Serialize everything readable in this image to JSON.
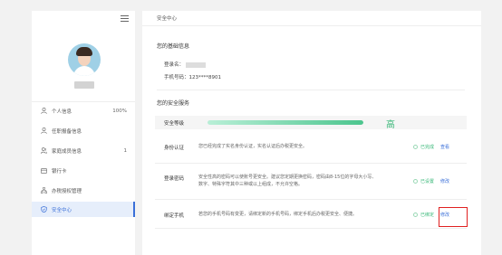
{
  "sidebar": {
    "items": [
      {
        "label": "个人信息",
        "icon": "user-icon",
        "count": "100%"
      },
      {
        "label": "任职报备信息",
        "icon": "user-icon",
        "count": ""
      },
      {
        "label": "家庭成员信息",
        "icon": "users-icon",
        "count": "1"
      },
      {
        "label": "银行卡",
        "icon": "card-icon",
        "count": ""
      },
      {
        "label": "办税授权管理",
        "icon": "org-icon",
        "count": ""
      },
      {
        "label": "安全中心",
        "icon": "shield-icon",
        "count": ""
      }
    ]
  },
  "main": {
    "breadcrumb": "安全中心",
    "basic_title": "您的基础信息",
    "login_label": "登录名：",
    "phone_line": "手机号码：123****8901",
    "security_title": "您的安全服务",
    "level_label": "安全等级",
    "level_value": "高",
    "level_percent": 100,
    "rows": [
      {
        "name": "身份认证",
        "desc": "您已经完成了实名身份认证，实名认证后办税更安全。",
        "status": "已完成",
        "action": "查看"
      },
      {
        "name": "登录密码",
        "desc": "安全性高的密码可以使账号更安全。建议您定期更换密码，密码由8-15位的字母大小写、数字、特殊字符其中三种或以上组成，不允许空格。",
        "status": "已设置",
        "action": "修改"
      },
      {
        "name": "绑定手机",
        "desc": "若您的手机号码有变更，请绑定新的手机号码，绑定手机后办税更安全、便捷。",
        "status": "已绑定",
        "action": "修改"
      }
    ]
  },
  "colors": {
    "accent": "#3a6fd8",
    "success": "#3ab879",
    "highlight_border": "#e02020"
  }
}
